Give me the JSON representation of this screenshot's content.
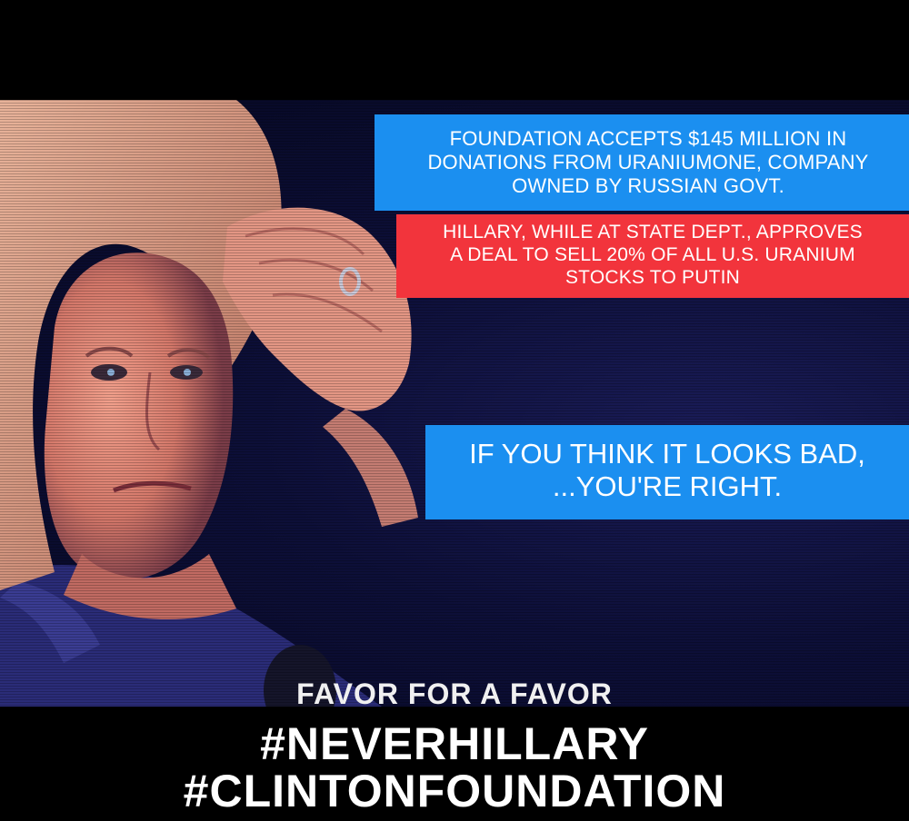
{
  "callouts": {
    "foundation": "FOUNDATION ACCEPTS $145 MILLION IN\nDONATIONS FROM URANIUMONE, COMPANY\nOWNED BY RUSSIAN GOVT.",
    "approval": "HILLARY, WHILE AT STATE DEPT., APPROVES\nA DEAL TO SELL 20% OF ALL U.S. URANIUM\nSTOCKS TO PUTIN",
    "punchline": "IF YOU THINK IT LOOKS BAD,\n...YOU'RE RIGHT."
  },
  "footer": {
    "favor": "FAVOR FOR A FAVOR",
    "hashtag_1": "#NEVERHILLARY",
    "hashtag_2": "#CLINTONFOUNDATION"
  },
  "colors": {
    "background": "#000000",
    "photo_backdrop": "#0d0f38",
    "callout_blue": "#1b8ff0",
    "callout_red": "#f2343c",
    "text": "#ffffff"
  }
}
